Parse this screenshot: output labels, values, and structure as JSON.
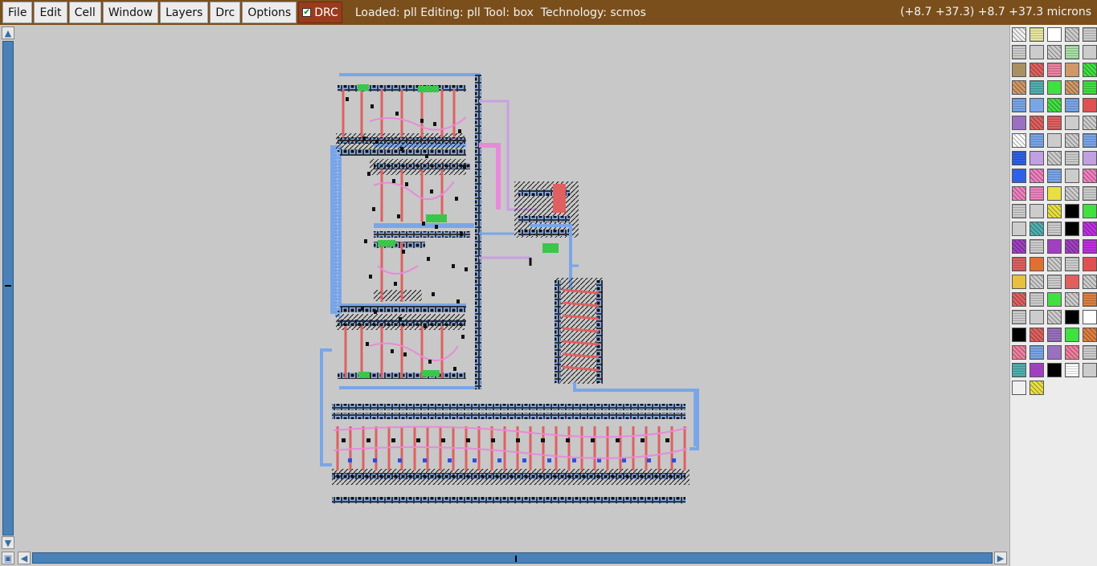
{
  "menubar": {
    "items": [
      "File",
      "Edit",
      "Cell",
      "Window",
      "Layers",
      "Drc",
      "Options"
    ],
    "drc_label": "DRC",
    "drc_checked": true,
    "status": "Loaded: pll Editing: pll Tool: box  Technology: scmos",
    "coords": "(+8.7 +37.3) +8.7 +37.3 microns",
    "bar_color": "#7a4f1c"
  },
  "scrollbars": {
    "up_icon": "arrow-up-icon",
    "down_icon": "arrow-down-icon",
    "left_icon": "arrow-left-icon",
    "right_icon": "arrow-right-icon",
    "corner_icon": "zoom-box-icon"
  },
  "layout_colors": {
    "metal1": "#7aa6e8",
    "metal2": "#e88ad8",
    "poly": "#e06060",
    "diffusion": "#4fd04f",
    "contact": "#111111",
    "background": "#c8c8c8"
  },
  "palette": {
    "columns": 5,
    "rows": 21,
    "swatches": [
      [
        "#f0f0f0",
        "#e8e8a0",
        "#ffffff",
        "#cccccc",
        "#cccccc"
      ],
      [
        "#cccccc",
        "#cccccc",
        "#cccccc",
        "#a8e0a8",
        "#cccccc"
      ],
      [
        "#a89060",
        "#e06060",
        "#f080a0",
        "#d09868",
        "#40e040"
      ],
      [
        "#d09868",
        "#50b0b0",
        "#40e040",
        "#d09868",
        "#40e040"
      ],
      [
        "#7aa6e8",
        "#7aa6e8",
        "#40e040",
        "#7aa6e8",
        "#e05050"
      ],
      [
        "#9a70c0",
        "#e06060",
        "#e06060",
        "#cccccc",
        "#cccccc"
      ],
      [
        "#ffffff",
        "#7aa6e8",
        "#cccccc",
        "#cccccc",
        "#7aa6e8"
      ],
      [
        "#3060e8",
        "#c0a0e0",
        "#cccccc",
        "#cccccc",
        "#c0a0e0"
      ],
      [
        "#3060e8",
        "#f080c0",
        "#7aa6e8",
        "#cccccc",
        "#f080c0"
      ],
      [
        "#f080c0",
        "#f080c0",
        "#e8e040",
        "#cccccc",
        "#cccccc"
      ],
      [
        "#cccccc",
        "#cccccc",
        "#e8e040",
        "#000000",
        "#40e040"
      ],
      [
        "#cccccc",
        "#50b0b0",
        "#cccccc",
        "#000000",
        "#c030e0"
      ],
      [
        "#a040c0",
        "#cccccc",
        "#a040c0",
        "#a040c0",
        "#c030e0"
      ],
      [
        "#e06060",
        "#e07030",
        "#cccccc",
        "#cccccc",
        "#e05050"
      ],
      [
        "#e8c040",
        "#cccccc",
        "#cccccc",
        "#e06060",
        "#cccccc"
      ],
      [
        "#e06060",
        "#cccccc",
        "#40e040",
        "#cccccc",
        "#e08040"
      ],
      [
        "#cccccc",
        "#cccccc",
        "#cccccc",
        "#000000",
        "#ffffff"
      ],
      [
        "#000000",
        "#e06060",
        "#9a70c0",
        "#40e040",
        "#e08040"
      ],
      [
        "#f080a0",
        "#7aa6e8",
        "#9a70c0",
        "#f080a0",
        "#cccccc"
      ],
      [
        "#50b0b0",
        "#a040c0",
        "#000000",
        "#ffffff",
        "#cccccc"
      ],
      [
        "#f0f0f0",
        "#e8e040",
        "",
        "",
        ""
      ]
    ]
  }
}
